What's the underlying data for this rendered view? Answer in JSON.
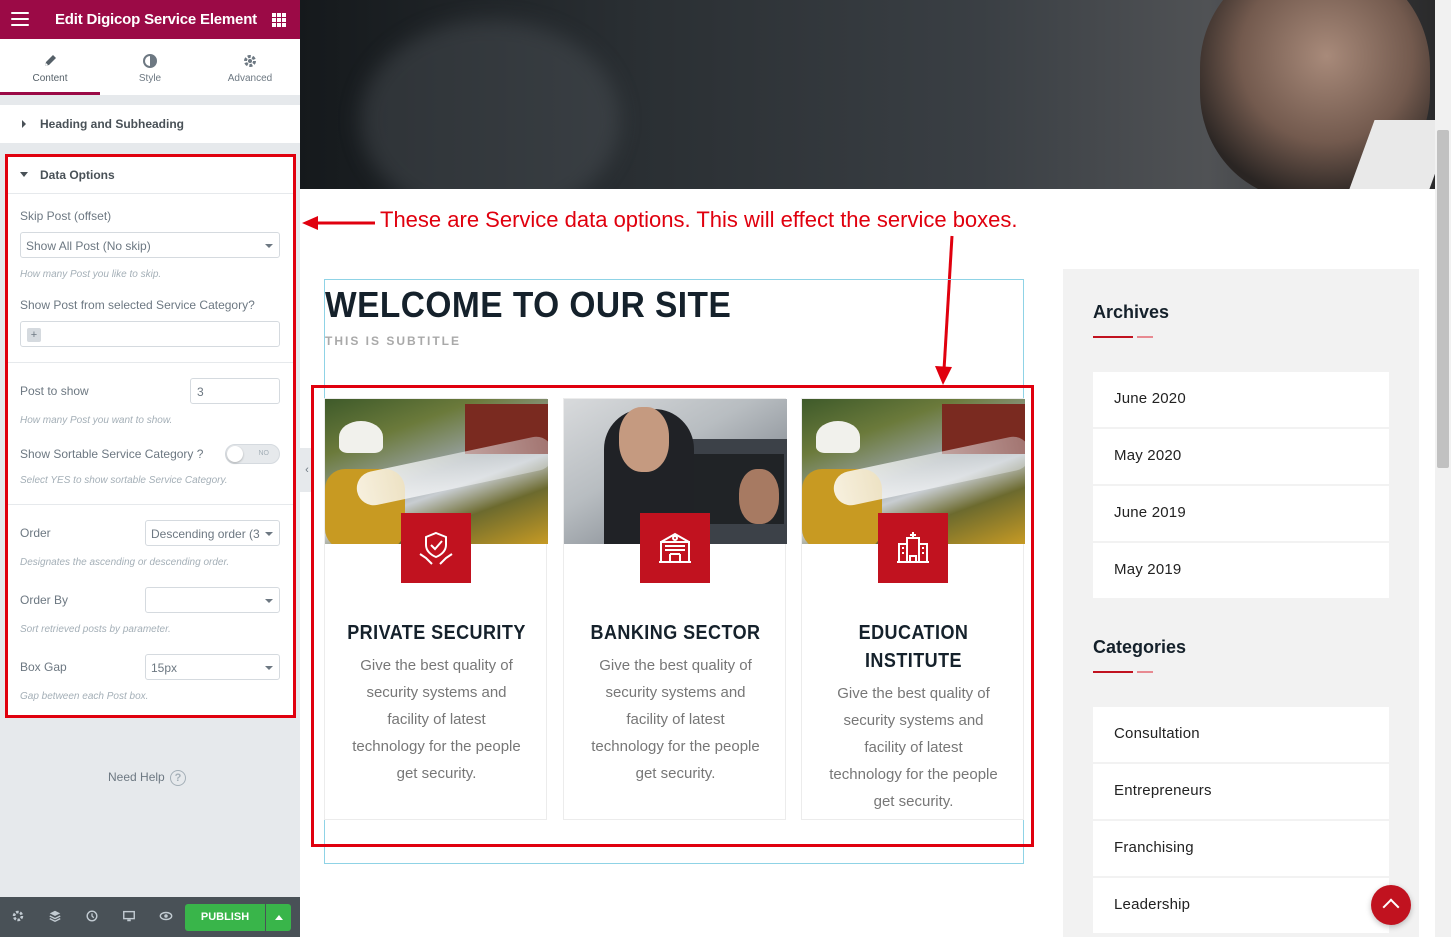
{
  "editor": {
    "title": "Edit Digicop Service Element",
    "tabs": [
      {
        "label": "Content",
        "icon": "pencil-icon"
      },
      {
        "label": "Style",
        "icon": "half-circle-icon"
      },
      {
        "label": "Advanced",
        "icon": "gear-icon"
      }
    ],
    "sections": {
      "heading": "Heading and Subheading",
      "data_options": "Data Options"
    },
    "controls": {
      "skip_post_label": "Skip Post (offset)",
      "skip_post_value": "Show All Post (No skip)",
      "skip_post_desc": "How many Post you like to skip.",
      "category_label": "Show Post from selected Service Category?",
      "category_add": "+",
      "post_to_show_label": "Post to show",
      "post_to_show_value": "3",
      "post_to_show_desc": "How many Post you want to show.",
      "sortable_label": "Show Sortable Service Category ?",
      "sortable_toggle": "NO",
      "sortable_desc": "Select YES to show sortable Service Category.",
      "order_label": "Order",
      "order_value": "Descending order (3",
      "order_desc": "Designates the ascending or descending order.",
      "order_by_label": "Order By",
      "order_by_value": "",
      "order_by_desc": "Sort retrieved posts by parameter.",
      "box_gap_label": "Box Gap",
      "box_gap_value": "15px",
      "box_gap_desc": "Gap between each Post box."
    },
    "need_help": "Need Help",
    "help_glyph": "?",
    "publish": "PUBLISH",
    "footer_icons": [
      "settings-icon",
      "layers-icon",
      "history-icon",
      "responsive-icon",
      "preview-eye-icon"
    ]
  },
  "annotation": "These are Service data options. This will effect the service boxes.",
  "preview": {
    "welcome": "WELCOME TO OUR SITE",
    "subtitle": "THIS IS SUBTITLE",
    "services": [
      {
        "title": "PRIVATE SECURITY",
        "desc": "Give the best quality of security systems and facility of latest technology for the people get security.",
        "icon": "shield-hands-icon"
      },
      {
        "title": "BANKING SECTOR",
        "desc": "Give the best quality of security systems and facility of latest technology for the people get security.",
        "icon": "bank-building-icon"
      },
      {
        "title": "EDUCATION INSTITUTE",
        "desc": "Give the best quality of security systems and facility of latest technology for the people get security.",
        "icon": "institute-building-icon"
      }
    ],
    "sidebar": {
      "archives_title": "Archives",
      "archives": [
        "June 2020",
        "May 2020",
        "June 2019",
        "May 2019"
      ],
      "categories_title": "Categories",
      "categories": [
        "Consultation",
        "Entrepreneurs",
        "Franchising",
        "Leadership"
      ]
    }
  },
  "colors": {
    "editor_brand": "#9b0a46",
    "accent_red": "#c1121f",
    "annotation_red": "#e0000e",
    "publish_green": "#39b54a"
  }
}
